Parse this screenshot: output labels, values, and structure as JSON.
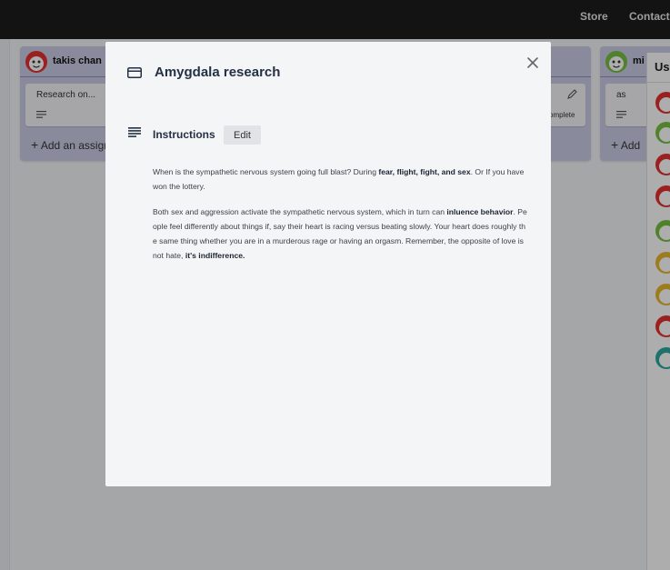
{
  "nav": {
    "store": "Store",
    "contact": "Contact"
  },
  "board": {
    "columns": [
      {
        "owner": "takis chan",
        "card_text": "Research on...",
        "add_label": "Add an assignment"
      },
      {
        "card_status": "omplete"
      },
      {
        "owner": "mi",
        "card_text": "as",
        "add_label": "Add"
      }
    ],
    "users_title": "Use"
  },
  "colors": {
    "avatar_red": "#e53232",
    "avatar_green": "#76c043",
    "avatar_yellow": "#e8b62f",
    "avatar_teal": "#2ba9a0",
    "column_bg": "#cbcde6",
    "modal_title": "#243044"
  },
  "modal": {
    "title": "Amygdala research",
    "title_icon": "card-icon",
    "close_icon": "close-icon",
    "section_icon": "description-icon",
    "section_title": "Instructions",
    "edit_label": "Edit",
    "para1": {
      "t1": "When is the sympathetic nervous system going full blast? During ",
      "b1": "fear, flight, fight, and sex",
      "t2": ". Or If you have won the lottery."
    },
    "para2": {
      "t1": "Both sex and aggression activate the sympathetic nervous system, which in turn can ",
      "b1": "inluence behavior",
      "t2": ". People feel differently about things if, say their heart is racing versus beating slowly. Your heart does roughly the same thing whether you are in a murderous rage or having an orgasm. Remember, the opposite of love is not hate, ",
      "b2": "it's indifference."
    }
  }
}
